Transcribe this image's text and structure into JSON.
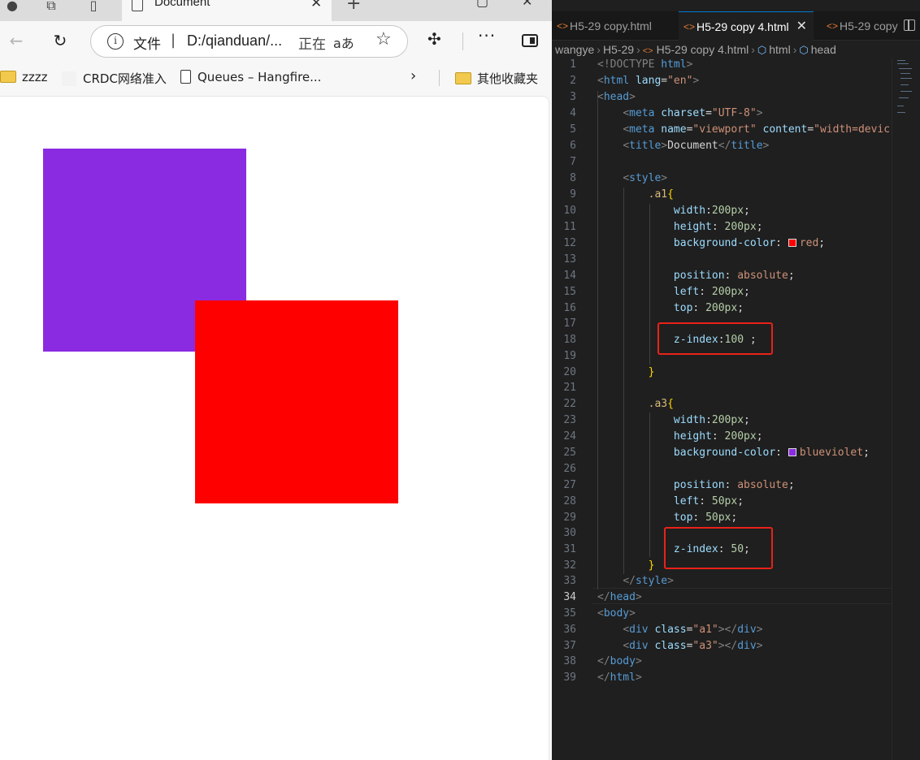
{
  "browser": {
    "tab_title": "Document",
    "tab_close": "✕",
    "new_tab": "+",
    "address": {
      "scheme_label": "文件",
      "separator": "|",
      "url": "D:/qianduan/...",
      "status": "正在",
      "read_aloud": "aあ"
    },
    "favorites": [
      {
        "label": "zzzz",
        "icon": "folder-icon"
      },
      {
        "label": "CRDC网络准入",
        "icon": "blank-icon"
      },
      {
        "label": "Queues – Hangfire...",
        "icon": "file-icon"
      },
      {
        "label": "其他收藏夹",
        "icon": "folder-icon"
      }
    ],
    "page": {
      "box_a3_color": "#8a2be2",
      "box_a1_color": "#ff0000"
    }
  },
  "editor": {
    "tabs": [
      {
        "label": "H5-29 copy.html"
      },
      {
        "label": "H5-29 copy 4.html",
        "active": true
      },
      {
        "label": "H5-29 copy"
      }
    ],
    "breadcrumbs": [
      "wangye",
      "H5-29",
      "H5-29 copy 4.html",
      "html",
      "head"
    ],
    "current_line": 34,
    "highlight_color": "#e8221a",
    "lines": [
      {
        "n": "1"
      },
      {
        "n": "2"
      },
      {
        "n": "3"
      },
      {
        "n": "4"
      },
      {
        "n": "5"
      },
      {
        "n": "6"
      },
      {
        "n": "7"
      },
      {
        "n": "8"
      },
      {
        "n": "9"
      },
      {
        "n": "10"
      },
      {
        "n": "11"
      },
      {
        "n": "12"
      },
      {
        "n": "13"
      },
      {
        "n": "14"
      },
      {
        "n": "15"
      },
      {
        "n": "16"
      },
      {
        "n": "17"
      },
      {
        "n": "18"
      },
      {
        "n": "19"
      },
      {
        "n": "20"
      },
      {
        "n": "21"
      },
      {
        "n": "22"
      },
      {
        "n": "23"
      },
      {
        "n": "24"
      },
      {
        "n": "25"
      },
      {
        "n": "26"
      },
      {
        "n": "27"
      },
      {
        "n": "28"
      },
      {
        "n": "29"
      },
      {
        "n": "30"
      },
      {
        "n": "31"
      },
      {
        "n": "32"
      },
      {
        "n": "33"
      },
      {
        "n": "34"
      },
      {
        "n": "35"
      },
      {
        "n": "36"
      },
      {
        "n": "37"
      },
      {
        "n": "38"
      },
      {
        "n": "39"
      }
    ],
    "code": {
      "l1_doctype": "<!DOCTYPE",
      "l1_html": "html",
      "l1_close": ">",
      "l2_open": "<",
      "l2_tag": "html",
      "l2_attr": "lang",
      "l2_eq": "=",
      "l2_val": "\"en\"",
      "l2_close": ">",
      "l3_tag": "head",
      "l4_tag": "meta",
      "l4_attr": "charset",
      "l4_val": "\"UTF-8\"",
      "l5_tag": "meta",
      "l5_attr1": "name",
      "l5_val1": "\"viewport\"",
      "l5_attr2": "content",
      "l5_val2": "\"width=devic",
      "l6_tag": "title",
      "l6_text": "Document",
      "l6_end": "title",
      "l8_tag": "style",
      "l9_sel": ".a1",
      "l9_brace": "{",
      "l10_prop": "width",
      "l10_val": "200px",
      "l11_prop": "height",
      "l11_val": "200px",
      "l12_prop": "background-color",
      "l12_val": "red",
      "l14_prop": "position",
      "l14_val": "absolute",
      "l15_prop": "left",
      "l15_val": "200px",
      "l16_prop": "top",
      "l16_val": "200px",
      "l18_prop": "z-index",
      "l18_val": "100",
      "l18_semi": " ;",
      "l20_brace": "}",
      "l22_sel": ".a3",
      "l22_brace": "{",
      "l23_prop": "width",
      "l23_val": "200px",
      "l24_prop": "height",
      "l24_val": "200px",
      "l25_prop": "background-color",
      "l25_val": "blueviolet",
      "l27_prop": "position",
      "l27_val": "absolute",
      "l28_prop": "left",
      "l28_val": "50px",
      "l29_prop": "top",
      "l29_val": "50px",
      "l31_prop": "z-index",
      "l31_val": "50",
      "l32_brace": "}",
      "l33_end": "style",
      "l34_end": "head",
      "l35_tag": "body",
      "l36_tag": "div",
      "l36_attr": "class",
      "l36_val": "\"a1\"",
      "l36_end": "div",
      "l37_tag": "div",
      "l37_attr": "class",
      "l37_val": "\"a3\"",
      "l37_end": "div",
      "l38_end": "body",
      "l39_end": "html"
    }
  }
}
